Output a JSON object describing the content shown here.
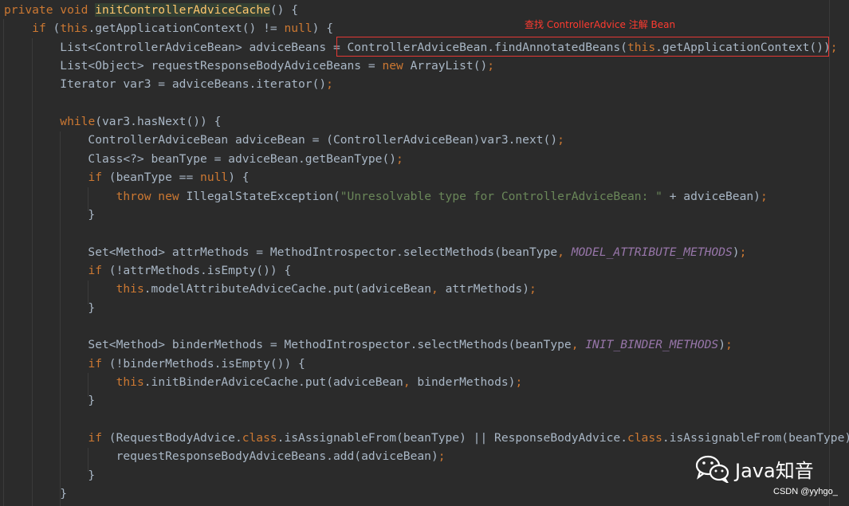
{
  "annotation": "查找 ControllerAdvice 注解 Bean",
  "watermark": {
    "brand": "Java知音",
    "credit": "CSDN @yyhgo_"
  },
  "code": [
    [
      [
        "kw",
        "private "
      ],
      [
        "kw",
        "void "
      ],
      [
        "fnhl",
        "initControllerAdviceCache"
      ],
      [
        "p",
        "() {"
      ]
    ],
    [
      [
        "p",
        "    "
      ],
      [
        "kw",
        "if "
      ],
      [
        "p",
        "("
      ],
      [
        "kw",
        "this"
      ],
      [
        "p",
        ".getApplicationContext() != "
      ],
      [
        "kw",
        "null"
      ],
      [
        "p",
        ") {"
      ]
    ],
    [
      [
        "p",
        "        List<ControllerAdviceBean> adviceBeans = ControllerAdviceBean.findAnnotatedBeans("
      ],
      [
        "kw",
        "this"
      ],
      [
        "p",
        ".getApplicationContext())"
      ],
      [
        "kw",
        ";"
      ]
    ],
    [
      [
        "p",
        "        List<Object> requestResponseBodyAdviceBeans = "
      ],
      [
        "kw",
        "new "
      ],
      [
        "p",
        "ArrayList()"
      ],
      [
        "kw",
        ";"
      ]
    ],
    [
      [
        "p",
        "        Iterator var3 = adviceBeans.iterator()"
      ],
      [
        "kw",
        ";"
      ]
    ],
    [
      [
        "p",
        ""
      ]
    ],
    [
      [
        "p",
        "        "
      ],
      [
        "kw",
        "while"
      ],
      [
        "p",
        "(var3.hasNext()) {"
      ]
    ],
    [
      [
        "p",
        "            ControllerAdviceBean adviceBean = (ControllerAdviceBean)var3.next()"
      ],
      [
        "kw",
        ";"
      ]
    ],
    [
      [
        "p",
        "            Class<?> beanType = adviceBean.getBeanType()"
      ],
      [
        "kw",
        ";"
      ]
    ],
    [
      [
        "p",
        "            "
      ],
      [
        "kw",
        "if "
      ],
      [
        "p",
        "(beanType == "
      ],
      [
        "kw",
        "null"
      ],
      [
        "p",
        ") {"
      ]
    ],
    [
      [
        "p",
        "                "
      ],
      [
        "kw",
        "throw new "
      ],
      [
        "p",
        "IllegalStateException("
      ],
      [
        "str",
        "\"Unresolvable type for ControllerAdviceBean: \""
      ],
      [
        "p",
        " + adviceBean)"
      ],
      [
        "kw",
        ";"
      ]
    ],
    [
      [
        "p",
        "            }"
      ]
    ],
    [
      [
        "p",
        ""
      ]
    ],
    [
      [
        "p",
        "            Set<Method> attrMethods = MethodIntrospector.selectMethods(beanType"
      ],
      [
        "kw",
        ", "
      ],
      [
        "const",
        "MODEL_ATTRIBUTE_METHODS"
      ],
      [
        "p",
        ")"
      ],
      [
        "kw",
        ";"
      ]
    ],
    [
      [
        "p",
        "            "
      ],
      [
        "kw",
        "if "
      ],
      [
        "p",
        "(!attrMethods.isEmpty()) {"
      ]
    ],
    [
      [
        "p",
        "                "
      ],
      [
        "kw",
        "this"
      ],
      [
        "p",
        ".modelAttributeAdviceCache.put(adviceBean"
      ],
      [
        "kw",
        ", "
      ],
      [
        "p",
        "attrMethods)"
      ],
      [
        "kw",
        ";"
      ]
    ],
    [
      [
        "p",
        "            }"
      ]
    ],
    [
      [
        "p",
        ""
      ]
    ],
    [
      [
        "p",
        "            Set<Method> binderMethods = MethodIntrospector.selectMethods(beanType"
      ],
      [
        "kw",
        ", "
      ],
      [
        "const",
        "INIT_BINDER_METHODS"
      ],
      [
        "p",
        ")"
      ],
      [
        "kw",
        ";"
      ]
    ],
    [
      [
        "p",
        "            "
      ],
      [
        "kw",
        "if "
      ],
      [
        "p",
        "(!binderMethods.isEmpty()) {"
      ]
    ],
    [
      [
        "p",
        "                "
      ],
      [
        "kw",
        "this"
      ],
      [
        "p",
        ".initBinderAdviceCache.put(adviceBean"
      ],
      [
        "kw",
        ", "
      ],
      [
        "p",
        "binderMethods)"
      ],
      [
        "kw",
        ";"
      ]
    ],
    [
      [
        "p",
        "            }"
      ]
    ],
    [
      [
        "p",
        ""
      ]
    ],
    [
      [
        "p",
        "            "
      ],
      [
        "kw",
        "if "
      ],
      [
        "p",
        "(RequestBodyAdvice."
      ],
      [
        "kw",
        "class"
      ],
      [
        "p",
        ".isAssignableFrom(beanType) || ResponseBodyAdvice."
      ],
      [
        "kw",
        "class"
      ],
      [
        "p",
        ".isAssignableFrom(beanType))"
      ]
    ],
    [
      [
        "p",
        "                requestResponseBodyAdviceBeans.add(adviceBean)"
      ],
      [
        "kw",
        ";"
      ]
    ],
    [
      [
        "p",
        "            }"
      ]
    ],
    [
      [
        "p",
        "        }"
      ]
    ]
  ]
}
